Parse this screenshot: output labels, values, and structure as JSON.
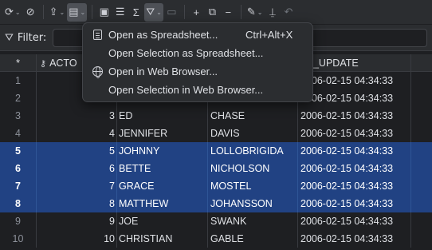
{
  "toolbar": {
    "icons": [
      "refresh-icon",
      "stop-icon",
      "upload-icon",
      "export-icon",
      "record-icon",
      "text-view-icon",
      "sum-icon",
      "filter-icon",
      "save-icon",
      "add-row-icon",
      "copy-row-icon",
      "delete-row-icon",
      "edit-icon",
      "stamp-icon",
      "undo-icon"
    ]
  },
  "filter": {
    "label": "Filter:",
    "value": ""
  },
  "grid": {
    "headers": [
      "*",
      "ACTO",
      "",
      "",
      "ST_UPDATE"
    ],
    "rows": [
      {
        "n": "1",
        "id": "",
        "first": "",
        "last": "",
        "upd": "2006-02-15 04:34:33",
        "sel": false
      },
      {
        "n": "2",
        "id": "",
        "first": "",
        "last": "",
        "upd": "2006-02-15 04:34:33",
        "sel": false
      },
      {
        "n": "3",
        "id": "3",
        "first": "ED",
        "last": "CHASE",
        "upd": "2006-02-15 04:34:33",
        "sel": false
      },
      {
        "n": "4",
        "id": "4",
        "first": "JENNIFER",
        "last": "DAVIS",
        "upd": "2006-02-15 04:34:33",
        "sel": false
      },
      {
        "n": "5",
        "id": "5",
        "first": "JOHNNY",
        "last": "LOLLOBRIGIDA",
        "upd": "2006-02-15 04:34:33",
        "sel": true
      },
      {
        "n": "6",
        "id": "6",
        "first": "BETTE",
        "last": "NICHOLSON",
        "upd": "2006-02-15 04:34:33",
        "sel": true
      },
      {
        "n": "7",
        "id": "7",
        "first": "GRACE",
        "last": "MOSTEL",
        "upd": "2006-02-15 04:34:33",
        "sel": true
      },
      {
        "n": "8",
        "id": "8",
        "first": "MATTHEW",
        "last": "JOHANSSON",
        "upd": "2006-02-15 04:34:33",
        "sel": true
      },
      {
        "n": "9",
        "id": "9",
        "first": "JOE",
        "last": "SWANK",
        "upd": "2006-02-15 04:34:33",
        "sel": false
      },
      {
        "n": "10",
        "id": "10",
        "first": "CHRISTIAN",
        "last": "GABLE",
        "upd": "2006-02-15 04:34:33",
        "sel": false
      }
    ]
  },
  "menu": {
    "items": [
      {
        "label": "Open as Spreadsheet...",
        "shortcut": "Ctrl+Alt+X",
        "icon": "spreadsheet-icon"
      },
      {
        "label": "Open Selection as Spreadsheet...",
        "shortcut": "",
        "icon": ""
      },
      {
        "label": "Open in Web Browser...",
        "shortcut": "",
        "icon": "globe-icon"
      },
      {
        "label": "Open Selection in Web Browser...",
        "shortcut": "",
        "icon": ""
      }
    ]
  },
  "colors": {
    "background": "#1e1f22",
    "panel": "#2b2d30",
    "selection": "#214283"
  }
}
